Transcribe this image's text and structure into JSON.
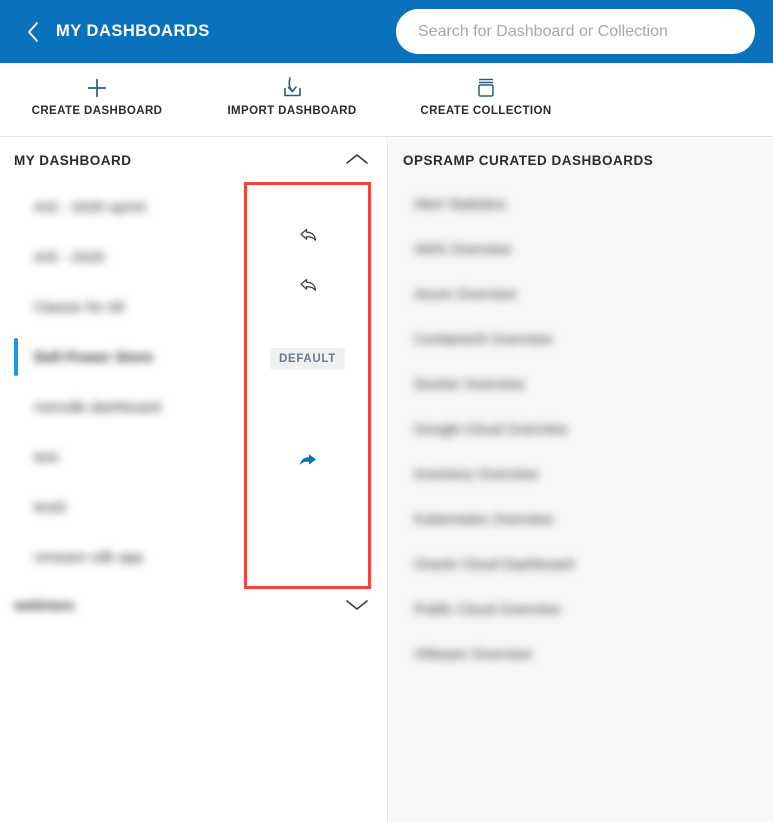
{
  "header": {
    "title": "MY DASHBOARDS",
    "back_icon": "chevron-left-icon",
    "brand_color": "#0a72bd"
  },
  "search": {
    "placeholder": "Search for Dashboard or Collection",
    "value": ""
  },
  "toolbar": {
    "items": [
      {
        "label": "CREATE DASHBOARD",
        "icon": "plus-icon"
      },
      {
        "label": "IMPORT DASHBOARD",
        "icon": "import-download-icon"
      },
      {
        "label": "CREATE COLLECTION",
        "icon": "collection-stack-icon"
      }
    ]
  },
  "left_panel": {
    "section_title": "MY DASHBOARD",
    "expanded": true,
    "chevron_icon": "chevron-up-icon",
    "rows": [
      {
        "name": "AIS - 2020 sprint",
        "selected": false,
        "action": "unshare-icon"
      },
      {
        "name": "AIS - 2020",
        "selected": false,
        "action": "unshare-icon"
      },
      {
        "name": "Classic for All",
        "selected": false,
        "action": "none"
      },
      {
        "name": "Dell Power Store",
        "selected": true,
        "action": "default-badge"
      },
      {
        "name": "menulik dashboard",
        "selected": false,
        "action": "none"
      },
      {
        "name": "test",
        "selected": false,
        "action": "share-icon"
      },
      {
        "name": "test2",
        "selected": false,
        "action": "none"
      },
      {
        "name": "vmware sdk app",
        "selected": false,
        "action": "none"
      }
    ],
    "default_badge_label": "DEFAULT",
    "collapsed_section": {
      "title": "webinars",
      "chevron_icon": "chevron-down-icon"
    }
  },
  "right_panel": {
    "section_title": "OPSRAMP CURATED DASHBOARDS",
    "rows": [
      {
        "name": "Alert Statistics"
      },
      {
        "name": "AWS Overview"
      },
      {
        "name": "Azure Overview"
      },
      {
        "name": "ContainerD Overview"
      },
      {
        "name": "Docker Overview"
      },
      {
        "name": "Google Cloud Overview"
      },
      {
        "name": "Inventory Overview"
      },
      {
        "name": "Kubernetes Overview"
      },
      {
        "name": "Oracle Cloud Dashboard"
      },
      {
        "name": "Public Cloud Overview"
      },
      {
        "name": "VMware Overview"
      }
    ]
  },
  "annotation": {
    "callout_color": "#f9423a",
    "shape": "rectangle"
  }
}
